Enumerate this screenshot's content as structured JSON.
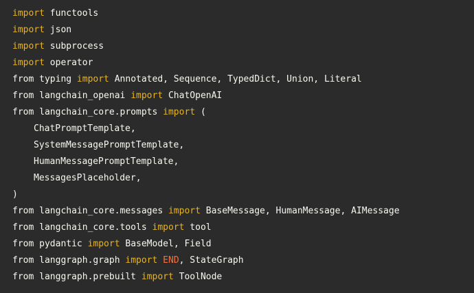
{
  "colors": {
    "background": "#2b2b2b",
    "text": "#f8f8f2",
    "keyword": "#e6b422",
    "constant": "#f5713b"
  },
  "lines": [
    [
      {
        "k": "keyword",
        "t": "import"
      },
      {
        "k": "plain",
        "t": " functools"
      }
    ],
    [
      {
        "k": "keyword",
        "t": "import"
      },
      {
        "k": "plain",
        "t": " json"
      }
    ],
    [
      {
        "k": "keyword",
        "t": "import"
      },
      {
        "k": "plain",
        "t": " subprocess"
      }
    ],
    [
      {
        "k": "keyword",
        "t": "import"
      },
      {
        "k": "plain",
        "t": " operator"
      }
    ],
    [
      {
        "k": "plain",
        "t": "from typing "
      },
      {
        "k": "keyword",
        "t": "import"
      },
      {
        "k": "plain",
        "t": " Annotated, Sequence, TypedDict, Union, Literal"
      }
    ],
    [
      {
        "k": "plain",
        "t": "from langchain_openai "
      },
      {
        "k": "keyword",
        "t": "import"
      },
      {
        "k": "plain",
        "t": " ChatOpenAI"
      }
    ],
    [
      {
        "k": "plain",
        "t": "from langchain_core.prompts "
      },
      {
        "k": "keyword",
        "t": "import"
      },
      {
        "k": "plain",
        "t": " ("
      }
    ],
    [
      {
        "k": "indent",
        "t": ""
      },
      {
        "k": "plain",
        "t": "ChatPromptTemplate,"
      }
    ],
    [
      {
        "k": "indent",
        "t": ""
      },
      {
        "k": "plain",
        "t": "SystemMessagePromptTemplate,"
      }
    ],
    [
      {
        "k": "indent",
        "t": ""
      },
      {
        "k": "plain",
        "t": "HumanMessagePromptTemplate,"
      }
    ],
    [
      {
        "k": "indent",
        "t": ""
      },
      {
        "k": "plain",
        "t": "MessagesPlaceholder,"
      }
    ],
    [
      {
        "k": "plain",
        "t": ")"
      }
    ],
    [
      {
        "k": "plain",
        "t": "from langchain_core.messages "
      },
      {
        "k": "keyword",
        "t": "import"
      },
      {
        "k": "plain",
        "t": " BaseMessage, HumanMessage, AIMessage"
      }
    ],
    [
      {
        "k": "plain",
        "t": "from langchain_core.tools "
      },
      {
        "k": "keyword",
        "t": "import"
      },
      {
        "k": "plain",
        "t": " tool"
      }
    ],
    [
      {
        "k": "plain",
        "t": "from pydantic "
      },
      {
        "k": "keyword",
        "t": "import"
      },
      {
        "k": "plain",
        "t": " BaseModel, Field"
      }
    ],
    [
      {
        "k": "plain",
        "t": "from langgraph.graph "
      },
      {
        "k": "keyword",
        "t": "import"
      },
      {
        "k": "plain",
        "t": " "
      },
      {
        "k": "constant",
        "t": "END"
      },
      {
        "k": "plain",
        "t": ", StateGraph"
      }
    ],
    [
      {
        "k": "plain",
        "t": "from langgraph.prebuilt "
      },
      {
        "k": "keyword",
        "t": "import"
      },
      {
        "k": "plain",
        "t": " ToolNode"
      }
    ]
  ]
}
